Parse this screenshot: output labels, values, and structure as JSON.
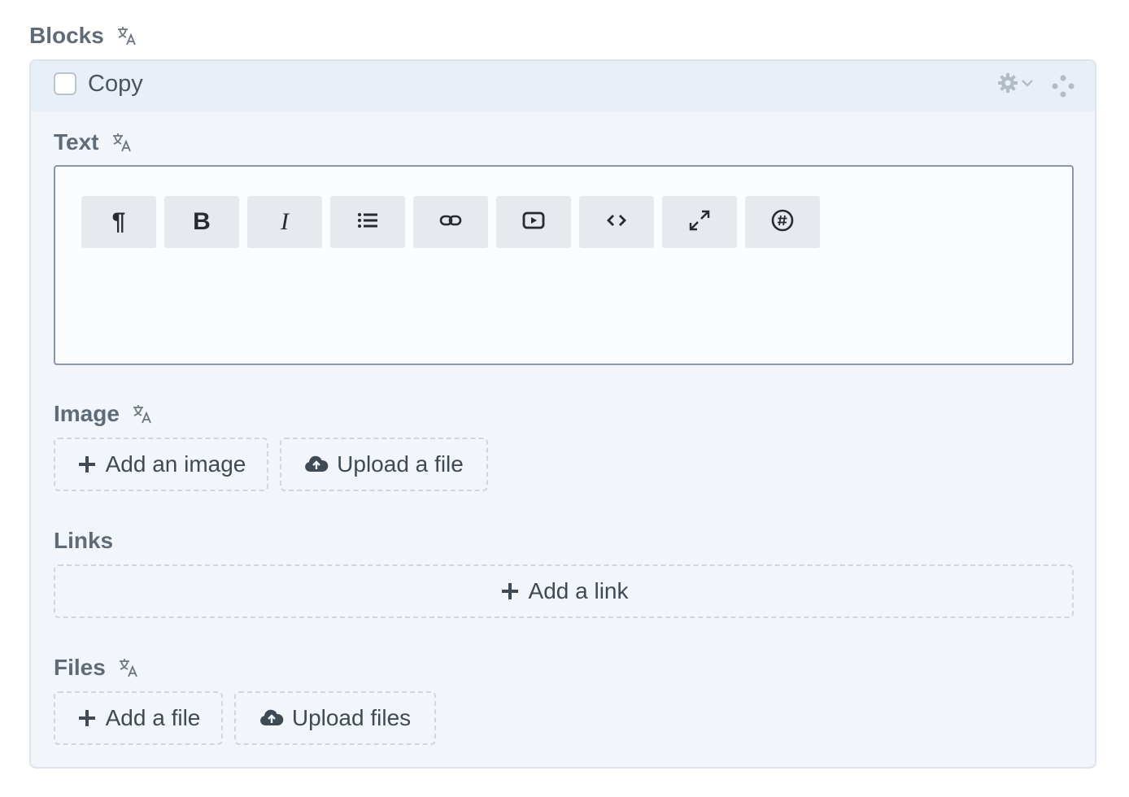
{
  "blocks_label": "Blocks",
  "block": {
    "title": "Copy",
    "checkbox_checked": false,
    "fields": {
      "text": {
        "label": "Text",
        "toolbar": [
          {
            "name": "paragraph-icon",
            "glyph": "¶"
          },
          {
            "name": "bold-icon",
            "glyph": "B"
          },
          {
            "name": "italic-icon",
            "glyph": "I"
          },
          {
            "name": "list-icon",
            "glyph": ""
          },
          {
            "name": "link-icon",
            "glyph": ""
          },
          {
            "name": "video-icon",
            "glyph": ""
          },
          {
            "name": "code-icon",
            "glyph": ""
          },
          {
            "name": "fullscreen-icon",
            "glyph": ""
          },
          {
            "name": "hashtag-icon",
            "glyph": ""
          }
        ]
      },
      "image": {
        "label": "Image",
        "add_label": "Add an image",
        "upload_label": "Upload a file"
      },
      "links": {
        "label": "Links",
        "add_label": "Add a link"
      },
      "files": {
        "label": "Files",
        "add_label": "Add a file",
        "upload_label": "Upload files"
      }
    }
  },
  "colors": {
    "block_bg": "#f2f5fa",
    "header_bg": "#e8eff7",
    "label": "#5f6b77",
    "toolbar_bg": "#e6e9ee"
  }
}
